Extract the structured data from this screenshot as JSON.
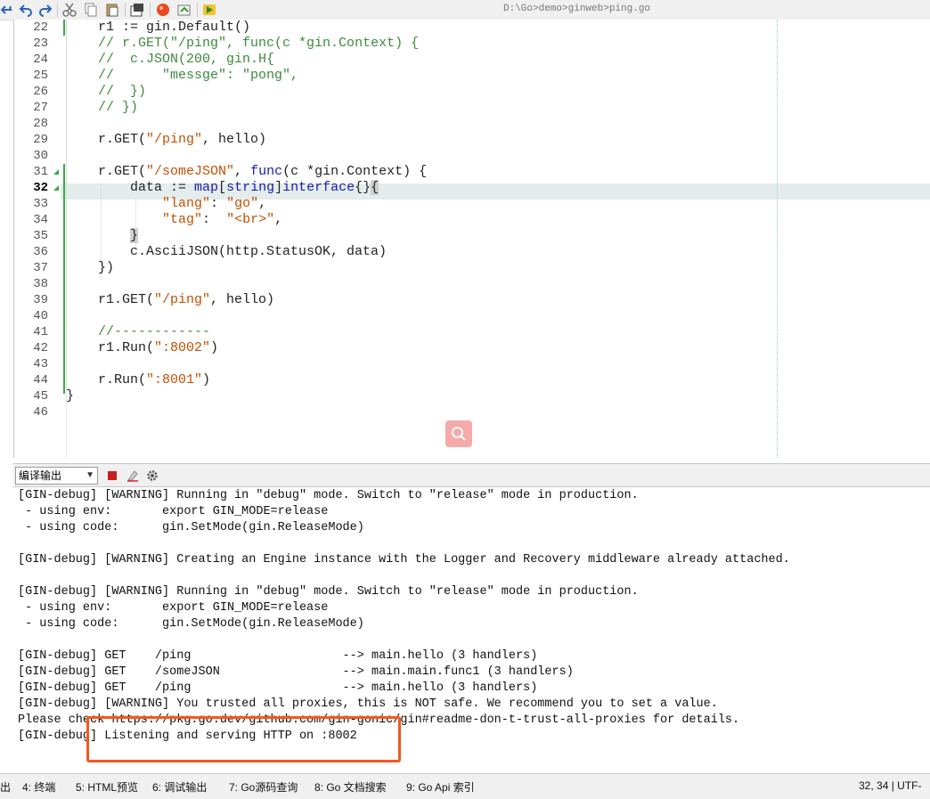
{
  "toolbar": {
    "file_path": "D:\\Go>demo>ginweb>ping.go",
    "buttons": [
      "undo-icon",
      "redo-icon",
      "cut-icon",
      "copy-icon",
      "paste-icon",
      "save-icon",
      "record-icon",
      "export-icon",
      "run-icon"
    ]
  },
  "editor": {
    "lines": [
      {
        "num": "22",
        "text": "    r1 := gin.Default()"
      },
      {
        "num": "23",
        "text": "    // r.GET(\"/ping\", func(c *gin.Context) {"
      },
      {
        "num": "24",
        "text": "    //  c.JSON(200, gin.H{"
      },
      {
        "num": "25",
        "text": "    //      \"messge\": \"pong\","
      },
      {
        "num": "26",
        "text": "    //  })"
      },
      {
        "num": "27",
        "text": "    // })"
      },
      {
        "num": "28",
        "text": ""
      },
      {
        "num": "29",
        "text": "    r.GET(\"/ping\", hello)"
      },
      {
        "num": "30",
        "text": ""
      },
      {
        "num": "31",
        "text": "    r.GET(\"/someJSON\", func(c *gin.Context) {"
      },
      {
        "num": "32",
        "text": "        data := map[string]interface{}{"
      },
      {
        "num": "33",
        "text": "            \"lang\": \"go\","
      },
      {
        "num": "34",
        "text": "            \"tag\":  \"<br>\","
      },
      {
        "num": "35",
        "text": "        }"
      },
      {
        "num": "36",
        "text": "        c.AsciiJSON(http.StatusOK, data)"
      },
      {
        "num": "37",
        "text": "    })"
      },
      {
        "num": "38",
        "text": ""
      },
      {
        "num": "39",
        "text": "    r1.GET(\"/ping\", hello)"
      },
      {
        "num": "40",
        "text": ""
      },
      {
        "num": "41",
        "text": "    //------------"
      },
      {
        "num": "42",
        "text": "    r1.Run(\":8002\")"
      },
      {
        "num": "43",
        "text": ""
      },
      {
        "num": "44",
        "text": "    r.Run(\":8001\")"
      },
      {
        "num": "45",
        "text": "}"
      },
      {
        "num": "46",
        "text": ""
      }
    ],
    "active_line": "32"
  },
  "output_panel": {
    "selector_value": "编译输出",
    "lines": [
      "[GIN-debug] [WARNING] Running in \"debug\" mode. Switch to \"release\" mode in production.",
      " - using env:       export GIN_MODE=release",
      " - using code:      gin.SetMode(gin.ReleaseMode)",
      "",
      "[GIN-debug] [WARNING] Creating an Engine instance with the Logger and Recovery middleware already attached.",
      "",
      "[GIN-debug] [WARNING] Running in \"debug\" mode. Switch to \"release\" mode in production.",
      " - using env:       export GIN_MODE=release",
      " - using code:      gin.SetMode(gin.ReleaseMode)",
      "",
      "[GIN-debug] GET    /ping                     --> main.hello (3 handlers)",
      "[GIN-debug] GET    /someJSON                 --> main.main.func1 (3 handlers)",
      "[GIN-debug] GET    /ping                     --> main.hello (3 handlers)",
      "[GIN-debug] [WARNING] You trusted all proxies, this is NOT safe. We recommend you to set a value.",
      "Please check https://pkg.go.dev/github.com/gin-gonic/gin#readme-don-t-trust-all-proxies for details.",
      "[GIN-debug] Listening and serving HTTP on :8002"
    ]
  },
  "statusbar": {
    "tabs": [
      "出",
      "4: 终端",
      "5: HTML预览",
      "6: 调试输出",
      "7: Go源码查询",
      "8: Go 文档搜索",
      "9: Go Api 索引"
    ],
    "cursor_pos": "32, 34",
    "encoding": "UTF-"
  },
  "colors": {
    "callout": "#f05a1e",
    "comment": "#3d8a3d",
    "string": "#c25000",
    "keyword": "#1a1ab0",
    "active_line_bg": "#e4ecec"
  }
}
